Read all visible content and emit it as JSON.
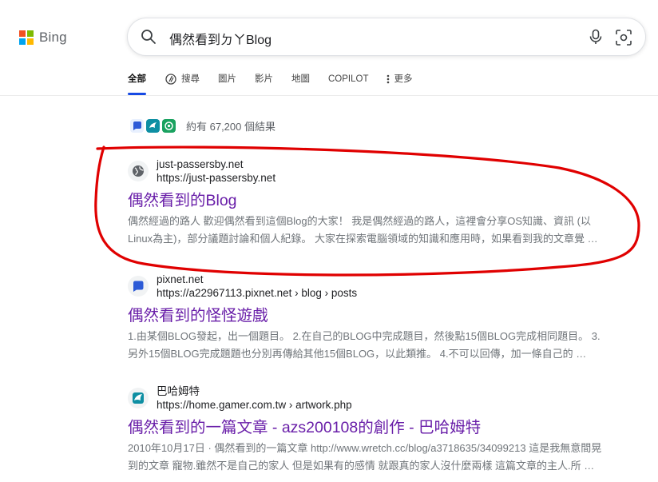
{
  "logo": {
    "text": "Bing",
    "colors": [
      "#f25022",
      "#7fba00",
      "#00a4ef",
      "#ffb900"
    ]
  },
  "search": {
    "query": "偶然看到ㄉㄚBlog"
  },
  "tabs": [
    {
      "label": "全部",
      "active": true
    },
    {
      "label": "搜尋",
      "icon": "copilot-search-icon"
    },
    {
      "label": "圖片"
    },
    {
      "label": "影片"
    },
    {
      "label": "地圖"
    },
    {
      "label": "COPILOT"
    },
    {
      "label": "更多",
      "icon": "kebab-icon"
    }
  ],
  "results_count": "約有 67,200 個結果",
  "accent_color": "#174ae4",
  "title_color": "#681da8",
  "annotation_color": "#e00000",
  "results": [
    {
      "site_name": "just-passersby.net",
      "url": "https://just-passersby.net",
      "icon": "globe-icon",
      "title": "偶然看到的Blog",
      "snippet_1": "偶然經過的路人 歡迎偶然看到這個Blog的大家！ 我是偶然經過的路人，這裡會分享OS知識、資訊 (以",
      "snippet_2": "Linux為主)，部分議題討論和個人紀錄。 大家在探索電腦領域的知識和應用時，如果看到我的文章覺 …"
    },
    {
      "site_name": "pixnet.net",
      "url": "https://a22967113.pixnet.net › blog › posts",
      "icon": "pixnet-icon",
      "title": "偶然看到的怪怪遊戲",
      "snippet_1": "1.由某個BLOG發起，出一個題目。 2.在自己的BLOG中完成題目，然後點15個BLOG完成相同題目。 3.",
      "snippet_2": "另外15個BLOG完成題題也分別再傳給其他15個BLOG，以此類推。 4.不可以回傳，加一條自己的 …"
    },
    {
      "site_name": "巴哈姆特",
      "url": "https://home.gamer.com.tw › artwork.php",
      "icon": "bahamut-icon",
      "title": "偶然看到的一篇文章 - azs200108的創作 - 巴哈姆特",
      "snippet_1": "2010年10月17日 · 偶然看到的一篇文章 http://www.wretch.cc/blog/a3718635/34099213 這是我無意間晃",
      "snippet_2": "到的文章 寵物.雖然不是自己的家人 但是如果有的感情 就跟真的家人沒什麼兩樣 這篇文章的主人.所 …"
    }
  ]
}
